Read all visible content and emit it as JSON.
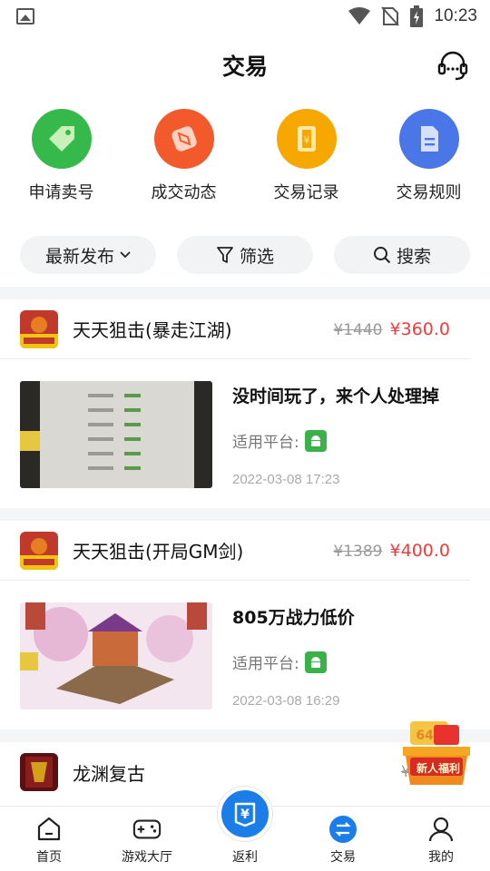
{
  "status_bar": {
    "time": "10:23"
  },
  "header": {
    "title": "交易"
  },
  "quick_actions": [
    {
      "label": "申请卖号",
      "color": "#35b94a",
      "icon": "tag-icon"
    },
    {
      "label": "成交动态",
      "color": "#f25a2b",
      "icon": "compass-icon"
    },
    {
      "label": "交易记录",
      "color": "#f6a700",
      "icon": "receipt-icon"
    },
    {
      "label": "交易规则",
      "color": "#4a76e8",
      "icon": "document-icon"
    }
  ],
  "filters": {
    "sort": "最新发布",
    "filter": "筛选",
    "search": "搜索"
  },
  "listings": [
    {
      "game": "天天狙击(暴走江湖)",
      "old_price": "¥1440",
      "price": "¥360.0",
      "title": "没时间玩了，来个人处理掉",
      "platform_label": "适用平台:",
      "time": "2022-03-08 17:23"
    },
    {
      "game": "天天狙击(开局GM剑)",
      "old_price": "¥1389",
      "price": "¥400.0",
      "title": "805万战力低价",
      "platform_label": "适用平台:",
      "time": "2022-03-08 16:29"
    },
    {
      "game": "龙渊复古",
      "old_price": "¥4810"
    }
  ],
  "promo": {
    "label": "新人福利"
  },
  "tabbar": [
    {
      "label": "首页",
      "icon": "home-icon"
    },
    {
      "label": "游戏大厅",
      "icon": "gamepad-icon"
    },
    {
      "label": "返利",
      "icon": "rebate-icon"
    },
    {
      "label": "交易",
      "icon": "exchange-icon"
    },
    {
      "label": "我的",
      "icon": "user-icon"
    }
  ],
  "colors": {
    "accent": "#1b7de8",
    "price_red": "#f23c3c",
    "android_green": "#3bb14a"
  }
}
